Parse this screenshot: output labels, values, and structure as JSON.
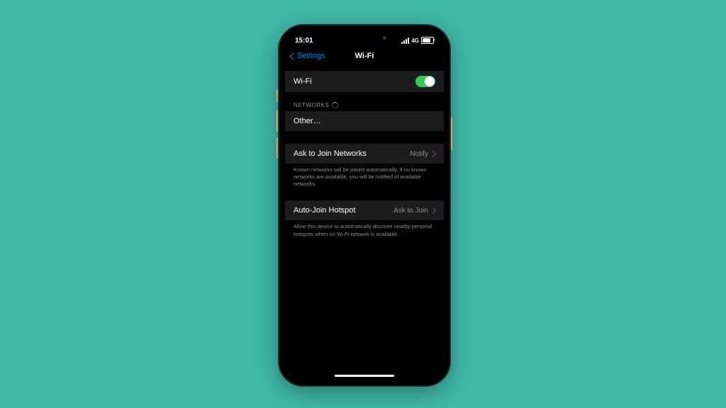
{
  "status": {
    "time": "15:01",
    "network": "4G"
  },
  "nav": {
    "back": "Settings",
    "title": "Wi-Fi"
  },
  "wifi": {
    "label": "Wi-Fi",
    "on": true
  },
  "networks": {
    "header": "NETWORKS",
    "other": "Other…"
  },
  "askJoin": {
    "label": "Ask to Join Networks",
    "value": "Notify",
    "footer": "Known networks will be joined automatically. If no known networks are available, you will be notified of available networks."
  },
  "autoHotspot": {
    "label": "Auto-Join Hotspot",
    "value": "Ask to Join",
    "footer": "Allow this device to automatically discover nearby personal hotspots when no Wi-Fi network is available."
  }
}
